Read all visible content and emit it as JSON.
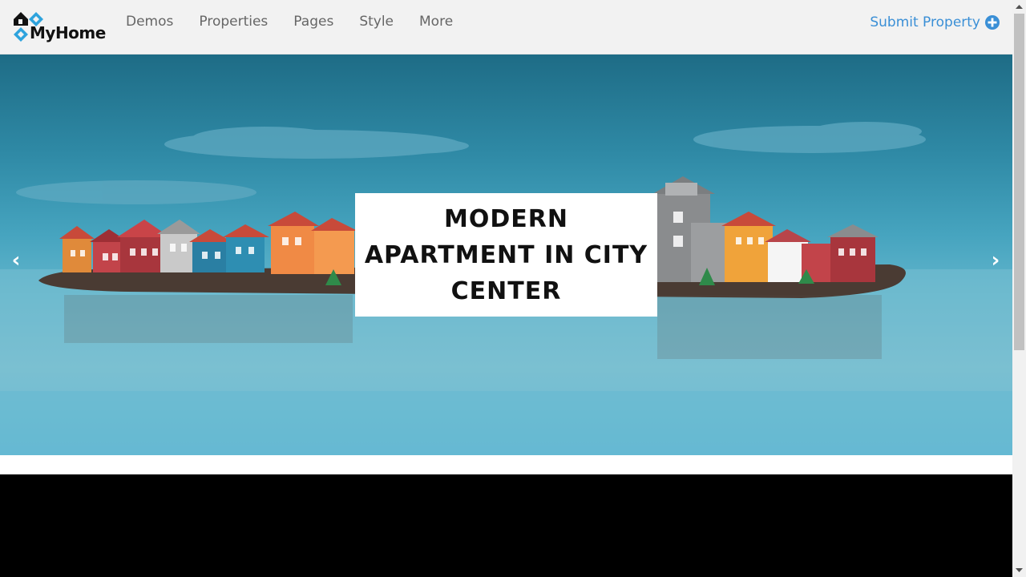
{
  "brand": {
    "name": "MyHome"
  },
  "nav": {
    "items": [
      {
        "label": "Demos"
      },
      {
        "label": "Properties"
      },
      {
        "label": "Pages"
      },
      {
        "label": "Style"
      },
      {
        "label": "More"
      }
    ]
  },
  "header": {
    "submit_label": "Submit Property",
    "submit_icon": "plus-circle-icon"
  },
  "hero": {
    "caption": "MODERN APARTMENT IN CITY CENTER",
    "prev_arrow": "‹",
    "next_arrow": "›"
  },
  "colors": {
    "header_bg": "#f2f2f2",
    "nav_text": "#666666",
    "accent": "#3a8fd6",
    "logo_blue": "#2ea3dd",
    "dark_band": "#000000"
  }
}
